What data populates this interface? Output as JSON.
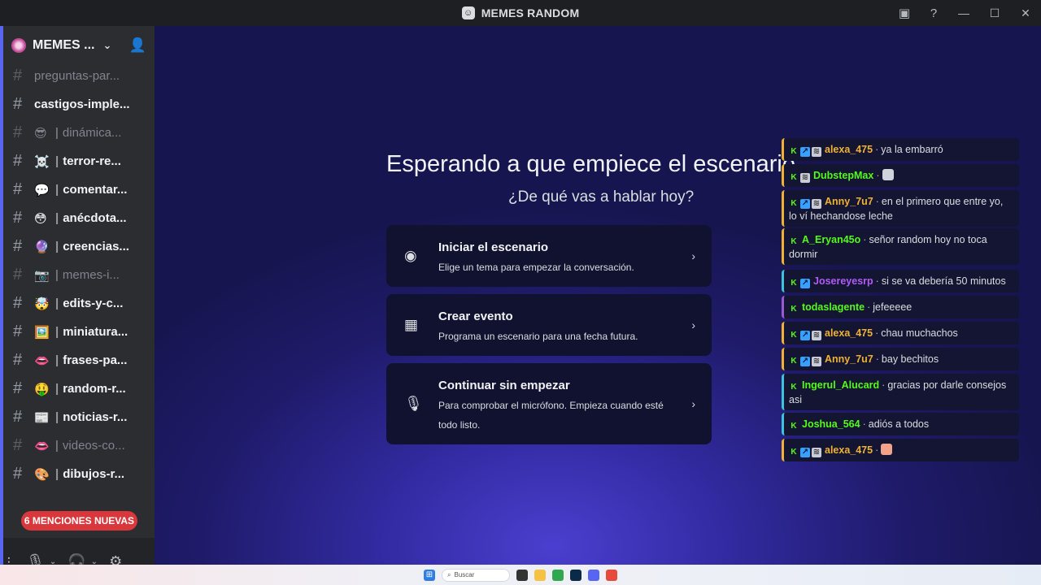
{
  "window": {
    "title": "MEMES RANDOM",
    "app_icon": "discord-icon"
  },
  "titlebar_actions": {
    "inbox_icon": "inbox-icon",
    "help_icon": "help-icon",
    "min": "—",
    "max": "☐",
    "close": "✕"
  },
  "server": {
    "name": "MEMES ...",
    "chevron": "⌄",
    "invite_icon": "add-person-icon"
  },
  "channels": [
    {
      "name": "preguntas-par...",
      "emoji": "",
      "muted": true
    },
    {
      "name": "castigos-imple...",
      "emoji": "",
      "muted": false
    },
    {
      "name": "dinámica...",
      "emoji": "😎",
      "muted": true
    },
    {
      "name": "terror-re...",
      "emoji": "☠️",
      "muted": false
    },
    {
      "name": "comentar...",
      "emoji": "💬",
      "muted": false
    },
    {
      "name": "anécdota...",
      "emoji": "😳",
      "muted": false
    },
    {
      "name": "creencias...",
      "emoji": "🔮",
      "muted": false
    },
    {
      "name": "memes-i...",
      "emoji": "📷",
      "muted": true
    },
    {
      "name": "edits-y-c...",
      "emoji": "🤯",
      "muted": false
    },
    {
      "name": "miniatura...",
      "emoji": "🖼️",
      "muted": false
    },
    {
      "name": "frases-pa...",
      "emoji": "👄",
      "muted": false
    },
    {
      "name": "random-r...",
      "emoji": "🤑",
      "muted": false
    },
    {
      "name": "noticias-r...",
      "emoji": "📰",
      "muted": false
    },
    {
      "name": "videos-co...",
      "emoji": "👄",
      "muted": true
    },
    {
      "name": "dibujos-r...",
      "emoji": "🎨",
      "muted": false
    }
  ],
  "mentions_pill": "6 MENCIONES NUEVAS",
  "userbar": {
    "dots": "⋮",
    "mic_icon": "microphone-icon",
    "headset_icon": "headphones-icon",
    "settings_icon": "gear-icon"
  },
  "stage": {
    "headline": "Esperando a que empiece el escenario",
    "subline": "¿De qué vas a hablar hoy?",
    "cards": [
      {
        "title": "Iniciar el escenario",
        "desc": "Elige un tema para empezar la conversación.",
        "icon": "stage-icon"
      },
      {
        "title": "Crear evento",
        "desc": "Programa un escenario para una fecha futura.",
        "icon": "calendar-icon"
      },
      {
        "title": "Continuar sin empezar",
        "desc": "Para comprobar el micrófono. Empieza cuando esté todo listo.",
        "icon": "microphone-icon"
      }
    ]
  },
  "chat": [
    {
      "user": "alexa_475",
      "text": "ya la embarró",
      "color": "#f0b232",
      "user_color": "#f0b232",
      "badges": [
        "K",
        "A",
        "S"
      ],
      "emote": ""
    },
    {
      "user": "DubstepMax",
      "text": "",
      "color": "#f0b232",
      "user_color": "#53fc18",
      "badges": [
        "K",
        "S"
      ],
      "emote": "#cfd3dc"
    },
    {
      "user": "Anny_7u7",
      "text": "en el primero que entre yo, lo ví hechandose leche",
      "color": "#f0b232",
      "user_color": "#f0b232",
      "badges": [
        "K",
        "A",
        "S"
      ],
      "emote": ""
    },
    {
      "user": "A_Eryan45o",
      "text": "señor random hoy no toca dormir",
      "color": "#f0b232",
      "user_color": "#53fc18",
      "badges": [
        "K"
      ],
      "emote": ""
    },
    {
      "user": "Josereyesrp",
      "text": "si se va debería 50 minutos",
      "color": "#3ec4d8",
      "user_color": "#b05cf5",
      "badges": [
        "K",
        "A"
      ],
      "emote": ""
    },
    {
      "user": "todaslagente",
      "text": "jefeeeee",
      "color": "#9b59d0",
      "user_color": "#53fc18",
      "badges": [
        "K"
      ],
      "emote": ""
    },
    {
      "user": "alexa_475",
      "text": "chau muchachos",
      "color": "#f0b232",
      "user_color": "#f0b232",
      "badges": [
        "K",
        "A",
        "S"
      ],
      "emote": ""
    },
    {
      "user": "Anny_7u7",
      "text": "bay bechitos",
      "color": "#f0b232",
      "user_color": "#f0b232",
      "badges": [
        "K",
        "A",
        "S"
      ],
      "emote": ""
    },
    {
      "user": "Ingerul_Alucard",
      "text": "gracias por darle consejos asi",
      "color": "#3ec4d8",
      "user_color": "#53fc18",
      "badges": [
        "K"
      ],
      "emote": ""
    },
    {
      "user": "Joshua_564",
      "text": "adiós a todos",
      "color": "#3ec4d8",
      "user_color": "#53fc18",
      "badges": [
        "K"
      ],
      "emote": ""
    },
    {
      "user": "alexa_475",
      "text": "",
      "color": "#f0b232",
      "user_color": "#f0b232",
      "badges": [
        "K",
        "A",
        "S"
      ],
      "emote": "#f2a48a"
    }
  ],
  "taskbar": {
    "search_placeholder": "Buscar"
  }
}
